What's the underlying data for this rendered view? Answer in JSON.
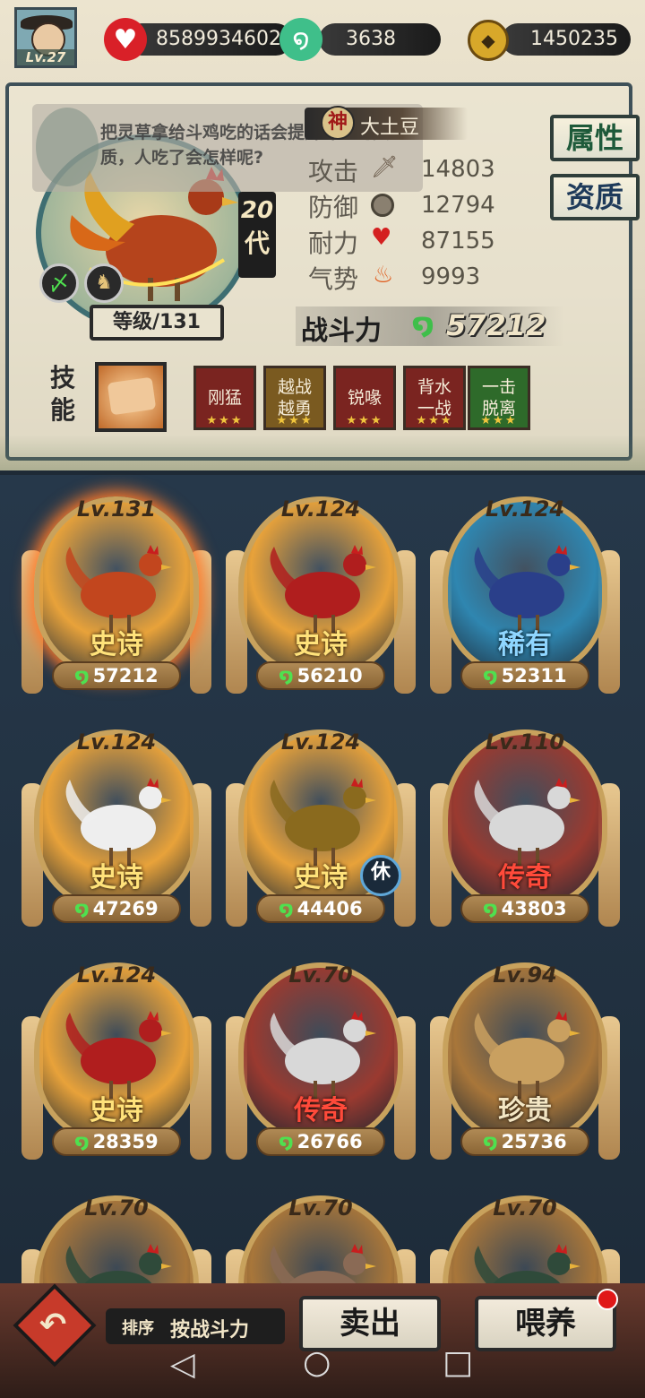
{
  "player": {
    "level": "Lv.27"
  },
  "resources": [
    {
      "icon": "heart-icon",
      "value": "8589934602"
    },
    {
      "icon": "jade-swirl-icon",
      "value": "3638"
    },
    {
      "icon": "coin-icon",
      "value": "1450235"
    }
  ],
  "tip": {
    "text": "把灵草拿给斗鸡吃的话会提升斗鸡的资质，人吃了会怎样呢?"
  },
  "chicken": {
    "tier": "神",
    "name": "大土豆",
    "generation": "20",
    "generation_unit": "代",
    "level_label": "等级/131",
    "stats": [
      {
        "label": "攻击",
        "icon": "sword-icon",
        "value": "14803"
      },
      {
        "label": "防御",
        "icon": "shield-icon",
        "value": "12794"
      },
      {
        "label": "耐力",
        "icon": "heart-icon",
        "value": "87155"
      },
      {
        "label": "气势",
        "icon": "flame-icon",
        "value": "9993"
      }
    ],
    "combat_label": "战斗力",
    "combat_power": "57212"
  },
  "tabs": {
    "attributes": "属性",
    "aptitude": "资质"
  },
  "skills": {
    "label": "技能",
    "items": [
      {
        "name": "刚猛",
        "color": "#7a2420",
        "stars": "★★★"
      },
      {
        "name": "越战越勇",
        "color": "#7a5a20",
        "stars": "★★★"
      },
      {
        "name": "锐喙",
        "color": "#7a2420",
        "stars": "★★★"
      },
      {
        "name": "背水一战",
        "color": "#7a2420",
        "stars": "★★★"
      },
      {
        "name": "一击脱离",
        "color": "#2e6a2a",
        "stars": "★★★"
      }
    ]
  },
  "roster": [
    {
      "level": "Lv.131",
      "rarity": "史诗",
      "rarity_color": "#ffe27a",
      "disc": "#e8a23a",
      "power": "57212",
      "bird": "#c2461e",
      "selected": true,
      "resting": false
    },
    {
      "level": "Lv.124",
      "rarity": "史诗",
      "rarity_color": "#ffe27a",
      "disc": "#e8a23a",
      "power": "56210",
      "bird": "#b01e1e",
      "selected": false,
      "resting": false
    },
    {
      "level": "Lv.124",
      "rarity": "稀有",
      "rarity_color": "#8fd6ff",
      "disc": "#2f86b0",
      "power": "52311",
      "bird": "#2a3f8a",
      "selected": false,
      "resting": false
    },
    {
      "level": "Lv.124",
      "rarity": "史诗",
      "rarity_color": "#ffe27a",
      "disc": "#e8a23a",
      "power": "47269",
      "bird": "#eeeeee",
      "selected": false,
      "resting": false
    },
    {
      "level": "Lv.124",
      "rarity": "史诗",
      "rarity_color": "#ffe27a",
      "disc": "#e8a23a",
      "power": "44406",
      "bird": "#8a6a1e",
      "selected": false,
      "resting": true
    },
    {
      "level": "Lv.110",
      "rarity": "传奇",
      "rarity_color": "#ff4a3a",
      "disc": "#9a3a30",
      "power": "43803",
      "bird": "#d8d8d8",
      "selected": false,
      "resting": false
    },
    {
      "level": "Lv.124",
      "rarity": "史诗",
      "rarity_color": "#ffe27a",
      "disc": "#e8a23a",
      "power": "28359",
      "bird": "#b01e1e",
      "selected": false,
      "resting": false
    },
    {
      "level": "Lv.70",
      "rarity": "传奇",
      "rarity_color": "#ff4a3a",
      "disc": "#9a3a30",
      "power": "26766",
      "bird": "#d8d8d8",
      "selected": false,
      "resting": false
    },
    {
      "level": "Lv.94",
      "rarity": "珍贵",
      "rarity_color": "#f3e6c4",
      "disc": "#a8763a",
      "power": "25736",
      "bird": "#c9a060",
      "selected": false,
      "resting": false
    },
    {
      "level": "Lv.70",
      "rarity": "",
      "rarity_color": "#ffffff",
      "disc": "#a8763a",
      "power": "",
      "bird": "#2f4a3a",
      "selected": false,
      "resting": false
    },
    {
      "level": "Lv.70",
      "rarity": "",
      "rarity_color": "#ffffff",
      "disc": "#a8763a",
      "power": "",
      "bird": "#8a6a55",
      "selected": false,
      "resting": false
    },
    {
      "level": "Lv.70",
      "rarity": "",
      "rarity_color": "#ffffff",
      "disc": "#a8763a",
      "power": "",
      "bird": "#2f4a3a",
      "selected": false,
      "resting": false
    }
  ],
  "rest_badge": "休",
  "bottom": {
    "sort_prefix": "排序",
    "sort_value": "按战斗力",
    "sell": "卖出",
    "feed": "喂养"
  },
  "colors": {
    "accent": "#c8a25d",
    "power_leaf": "#3fbf4a",
    "frame": "#3e5058"
  }
}
